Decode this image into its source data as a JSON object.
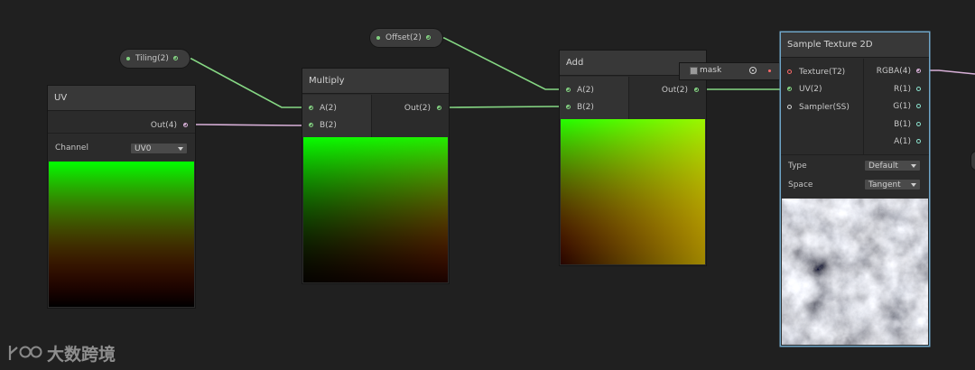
{
  "nodes": {
    "uv": {
      "title": "UV",
      "output": "Out(4)",
      "channel_label": "Channel",
      "channel_value": "UV0"
    },
    "tiling": {
      "label": "Tiling(2)"
    },
    "offset": {
      "label": "Offset(2)"
    },
    "multiply": {
      "title": "Multiply",
      "input_a": "A(2)",
      "input_b": "B(2)",
      "output": "Out(2)"
    },
    "add": {
      "title": "Add",
      "input_a": "A(2)",
      "input_b": "B(2)",
      "output": "Out(2)"
    },
    "mask": {
      "label": "mask"
    },
    "sample": {
      "title": "Sample Texture 2D",
      "inputs": [
        "Texture(T2)",
        "UV(2)",
        "Sampler(SS)"
      ],
      "outputs": [
        "RGBA(4)",
        "R(1)",
        "G(1)",
        "B(1)",
        "A(1)"
      ],
      "type_label": "Type",
      "type_value": "Default",
      "space_label": "Space",
      "space_value": "Tangent"
    }
  },
  "watermark": {
    "text": "大数跨境"
  },
  "colors": {
    "vector2_wire": "#86d884",
    "vector4_wire": "#d8b0d8",
    "texture_port": "#ff6a6a",
    "selection_outline": "#6fa6c8"
  }
}
